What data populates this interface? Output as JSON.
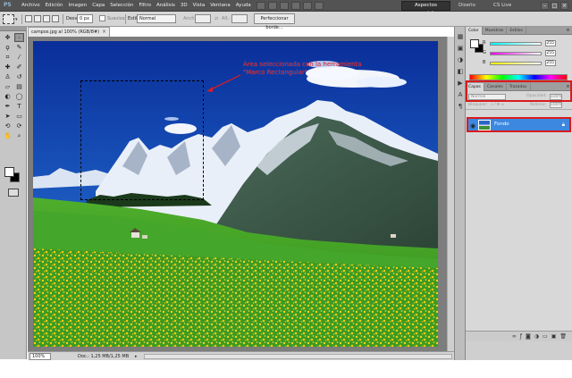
{
  "app": {
    "logo": "PS"
  },
  "menu": [
    "Archivo",
    "Edición",
    "Imagen",
    "Capa",
    "Selección",
    "Filtro",
    "Análisis",
    "3D",
    "Vista",
    "Ventana",
    "Ayuda"
  ],
  "menubar_right": {
    "workspace": "Aspectos esenciales",
    "design": "Diseño",
    "cslive": "CS Live"
  },
  "options_bar": {
    "desvan_label": "Desv.:",
    "desvan_value": "0 px",
    "suavizar_label": "Suavizar",
    "estilo_label": "Estilo:",
    "estilo_value": "Normal",
    "anch_label": "Anch.:",
    "alt_label": "Alt.:",
    "refine_button": "Perfeccionar borde..."
  },
  "tools": [
    {
      "icon": "move-icon",
      "glyph": "✥"
    },
    {
      "icon": "marquee-icon",
      "glyph": "⬚"
    },
    {
      "icon": "lasso-icon",
      "glyph": "ϙ"
    },
    {
      "icon": "quick-select-icon",
      "glyph": "✎"
    },
    {
      "icon": "crop-icon",
      "glyph": "⌗"
    },
    {
      "icon": "eyedropper-icon",
      "glyph": "⁄"
    },
    {
      "icon": "healing-icon",
      "glyph": "✚"
    },
    {
      "icon": "brush-icon",
      "glyph": "✐"
    },
    {
      "icon": "clone-stamp-icon",
      "glyph": "♙"
    },
    {
      "icon": "history-brush-icon",
      "glyph": "↺"
    },
    {
      "icon": "eraser-icon",
      "glyph": "▱"
    },
    {
      "icon": "gradient-icon",
      "glyph": "▤"
    },
    {
      "icon": "blur-icon",
      "glyph": "◐"
    },
    {
      "icon": "dodge-icon",
      "glyph": "◯"
    },
    {
      "icon": "pen-icon",
      "glyph": "✒"
    },
    {
      "icon": "type-icon",
      "glyph": "T"
    },
    {
      "icon": "path-select-icon",
      "glyph": "➤"
    },
    {
      "icon": "shape-icon",
      "glyph": "▭"
    },
    {
      "icon": "3d-rotate-icon",
      "glyph": "⟲"
    },
    {
      "icon": "3d-camera-icon",
      "glyph": "⟳"
    },
    {
      "icon": "hand-icon",
      "glyph": "✋"
    },
    {
      "icon": "zoom-icon",
      "glyph": "⌕"
    }
  ],
  "document": {
    "tab_title": "campos.jpg al 100% (RGB/8#)",
    "zoom": "100%",
    "info": "Doc.: 1,25 MB/1,25 MB"
  },
  "annotation": "Área seleccionada con la herramienta \"Marco Rectangular\"",
  "panels": {
    "color_tabs": [
      "Color",
      "Muestras",
      "Estilos"
    ],
    "color": {
      "r_label": "R",
      "g_label": "G",
      "b_label": "B",
      "r_value": "255",
      "g_value": "255",
      "b_value": "255"
    },
    "layers_tabs": [
      "Capas",
      "Canales",
      "Trazados"
    ],
    "blend_mode": "Normal",
    "opacity_label": "Opacidad:",
    "opacity_value": "100%",
    "lock_label": "Bloquear:",
    "fill_label": "Relleno:",
    "fill_value": "100%",
    "layer_name": "Fondo"
  },
  "colors": {
    "annotation_red": "#e21b1b",
    "layer_selected": "#3c88e0",
    "sky_blue": "#1d5fc4",
    "meadow_green": "#3a9a24",
    "flowers_yellow": "#f0d21a"
  }
}
